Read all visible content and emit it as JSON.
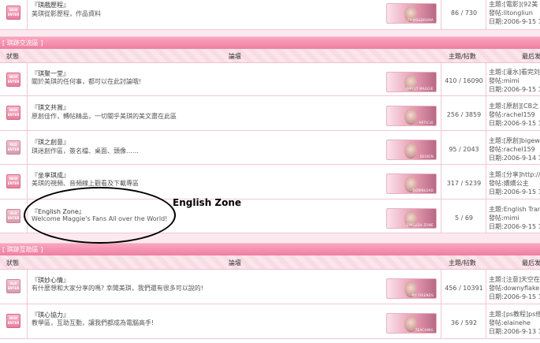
{
  "colors": {
    "accent": "#ee7fa1",
    "section_bar": "#f9a6c0",
    "border": "#f0c8d4",
    "header_bg": "#fbe6ec"
  },
  "top_row": {
    "badge": "NEW ENTER",
    "title": "『琪戲歷程』",
    "desc": "美琪從影歷程，作品資料",
    "thumb_caption": "FILMS&DRAMA",
    "count": "86 / 730",
    "last": [
      "主題:[電影](92美",
      "發帖:litongliun",
      "日期:2006-9-15 1"
    ]
  },
  "section1": {
    "title": "[ 琪跡交流區 ]",
    "headers": {
      "status": "狀態",
      "forum": "論壇",
      "count": "主題/帖數",
      "last": "最后发"
    },
    "rows": [
      {
        "badge": "NEW ENTER",
        "title": "『琪聚一堂』",
        "desc": "關於美琪的任何事，都可以在此討論哦!",
        "thumb_caption": "ABOUT MAGGIE",
        "count": "410 / 16090",
        "last": [
          "主題:[灌水]看完刘",
          "發帖:mimi",
          "日期:2006-9-15 1"
        ]
      },
      {
        "badge": "NEW ENTER",
        "title": "『琪文共賞』",
        "desc": "原創佳作，轉帖精品，一切關乎美琪的美文盡在此區",
        "thumb_caption": "ARTICLE",
        "count": "256 / 3859",
        "last": [
          "主題:[原創][CB之",
          "發帖:rachel159",
          "日期:2006-9-15 1"
        ]
      },
      {
        "badge": "OLD ENTER",
        "title": "『琪之創意』",
        "desc": "琪迷創作區，簽名檔、桌面、頭像……",
        "thumb_caption": "DESIGN",
        "count": "95 / 2043",
        "last": [
          "主題:[原創]bigew",
          "發帖:rachel159",
          "日期:2006-9-14 1"
        ]
      },
      {
        "badge": "NEW ENTER",
        "title": "『坐享琪成』",
        "desc": "美琪的視頻、音頻線上觀看及下載專區",
        "thumb_caption": "DOWNLOAD",
        "count": "317 / 5239",
        "last": [
          "主題:[分享]http://",
          "發帖:嬌嬌公主",
          "日期:2006-9-15 1"
        ]
      },
      {
        "badge": "OLD ENTER",
        "title": "『English Zone』",
        "desc": "Welcome Maggie's Fans All over the World!",
        "thumb_caption": "ENGLISH ZONE",
        "count": "5 / 69",
        "last": [
          "主題:English Tran",
          "發帖:mimi",
          "日期:2006-9-15 1"
        ]
      }
    ]
  },
  "section2": {
    "title": "[ 琪跡互助區 ]",
    "headers": {
      "status": "狀態",
      "forum": "論壇",
      "count": "主題/帖數",
      "last": "最后发"
    },
    "rows": [
      {
        "badge": "OLD ENTER",
        "title": "『琪妙心情』",
        "desc": "有什麼想和大家分享的嗎? 幸聞美琪，我們還有很多可以說的!",
        "thumb_caption": "MY FRIENDS",
        "count": "456 / 10391",
        "last": [
          "主題:[注意]天空在",
          "發帖:downyflake",
          "日期:2006-9-15 1"
        ]
      },
      {
        "badge": "NEW ENTER",
        "title": "『琪心協力』",
        "desc": "教學區，互助互動，讓我們都成為電腦高手!",
        "thumb_caption": "TEACHING",
        "count": "36 / 592",
        "last": [
          "主題:[ps教程]ps修",
          "發帖:elainehe",
          "日期:2006-9-13 1"
        ]
      }
    ]
  },
  "annotation": {
    "label": "English Zone"
  }
}
